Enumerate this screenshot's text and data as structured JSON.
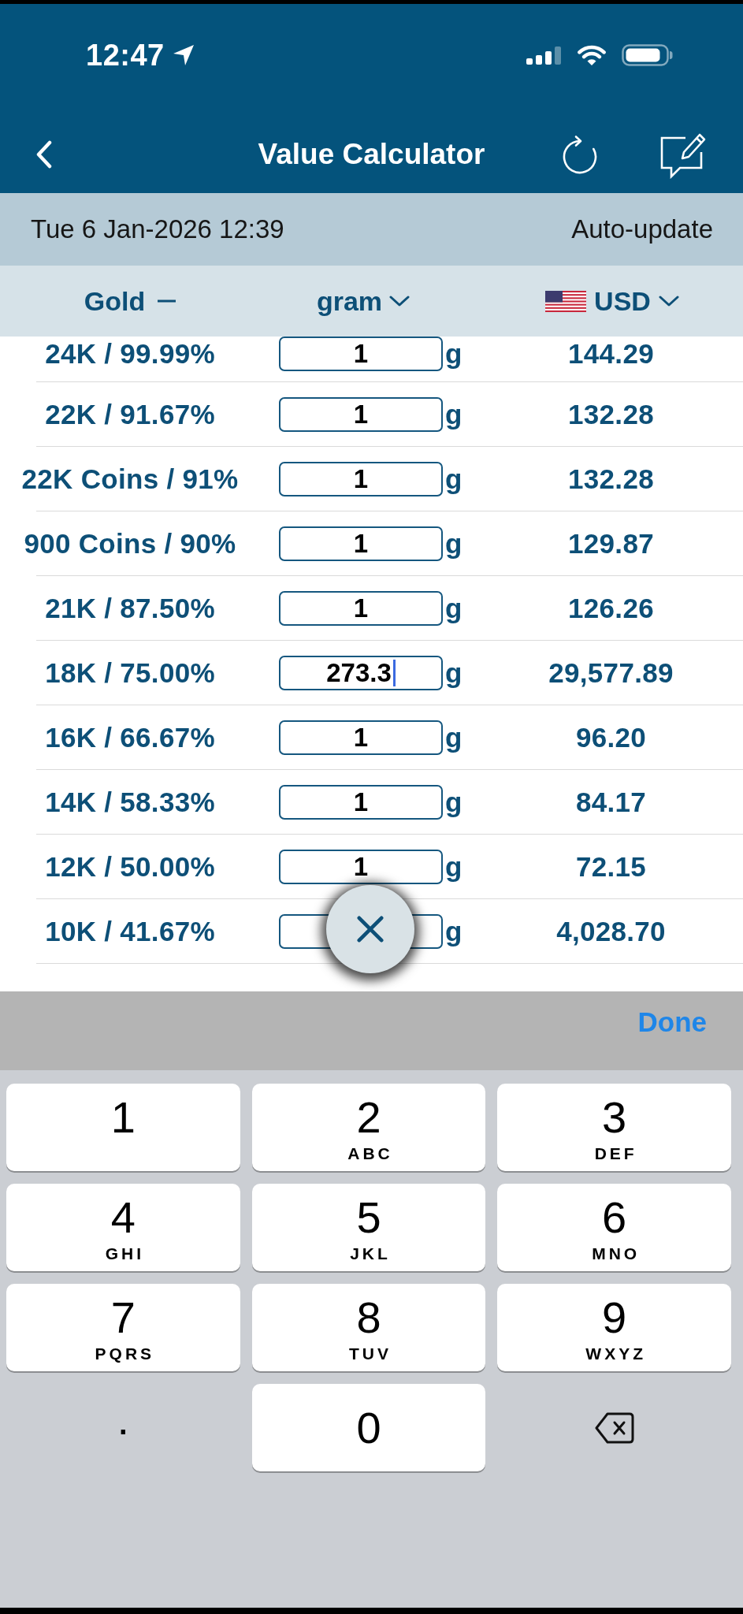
{
  "status_bar": {
    "time": "12:47"
  },
  "nav_bar": {
    "title": "Value Calculator"
  },
  "info_bar": {
    "timestamp": "Tue 6 Jan-2026 12:39",
    "auto_update": "Auto-update"
  },
  "column_headers": {
    "metal": "Gold",
    "unit": "gram",
    "currency": "USD"
  },
  "rows": [
    {
      "purity": "24K / 99.99%",
      "amount": "1",
      "unit": "g",
      "value": "144.29",
      "focused": false
    },
    {
      "purity": "22K / 91.67%",
      "amount": "1",
      "unit": "g",
      "value": "132.28",
      "focused": false
    },
    {
      "purity": "22K Coins / 91%",
      "amount": "1",
      "unit": "g",
      "value": "132.28",
      "focused": false
    },
    {
      "purity": "900 Coins / 90%",
      "amount": "1",
      "unit": "g",
      "value": "129.87",
      "focused": false
    },
    {
      "purity": "21K / 87.50%",
      "amount": "1",
      "unit": "g",
      "value": "126.26",
      "focused": false
    },
    {
      "purity": "18K / 75.00%",
      "amount": "273.3",
      "unit": "g",
      "value": "29,577.89",
      "focused": true
    },
    {
      "purity": "16K / 66.67%",
      "amount": "1",
      "unit": "g",
      "value": "96.20",
      "focused": false
    },
    {
      "purity": "14K / 58.33%",
      "amount": "1",
      "unit": "g",
      "value": "84.17",
      "focused": false
    },
    {
      "purity": "12K / 50.00%",
      "amount": "1",
      "unit": "g",
      "value": "72.15",
      "focused": false
    },
    {
      "purity": "10K / 41.67%",
      "unit": "g",
      "value": "4,028.70",
      "focused": false
    }
  ],
  "keyboard": {
    "done": "Done",
    "keys": [
      {
        "kind": "digit",
        "digit": "1"
      },
      {
        "kind": "digit",
        "digit": "2",
        "letters": "ABC"
      },
      {
        "kind": "digit",
        "digit": "3",
        "letters": "DEF"
      },
      {
        "kind": "digit",
        "digit": "4",
        "letters": "GHI"
      },
      {
        "kind": "digit",
        "digit": "5",
        "letters": "JKL"
      },
      {
        "kind": "digit",
        "digit": "6",
        "letters": "MNO"
      },
      {
        "kind": "digit",
        "digit": "7",
        "letters": "PQRS"
      },
      {
        "kind": "digit",
        "digit": "8",
        "letters": "TUV"
      },
      {
        "kind": "digit",
        "digit": "9",
        "letters": "WXYZ"
      },
      {
        "kind": "digit",
        "digit": "0"
      },
      {
        "kind": "decimal",
        "label": "."
      },
      {
        "kind": "delete"
      }
    ]
  }
}
